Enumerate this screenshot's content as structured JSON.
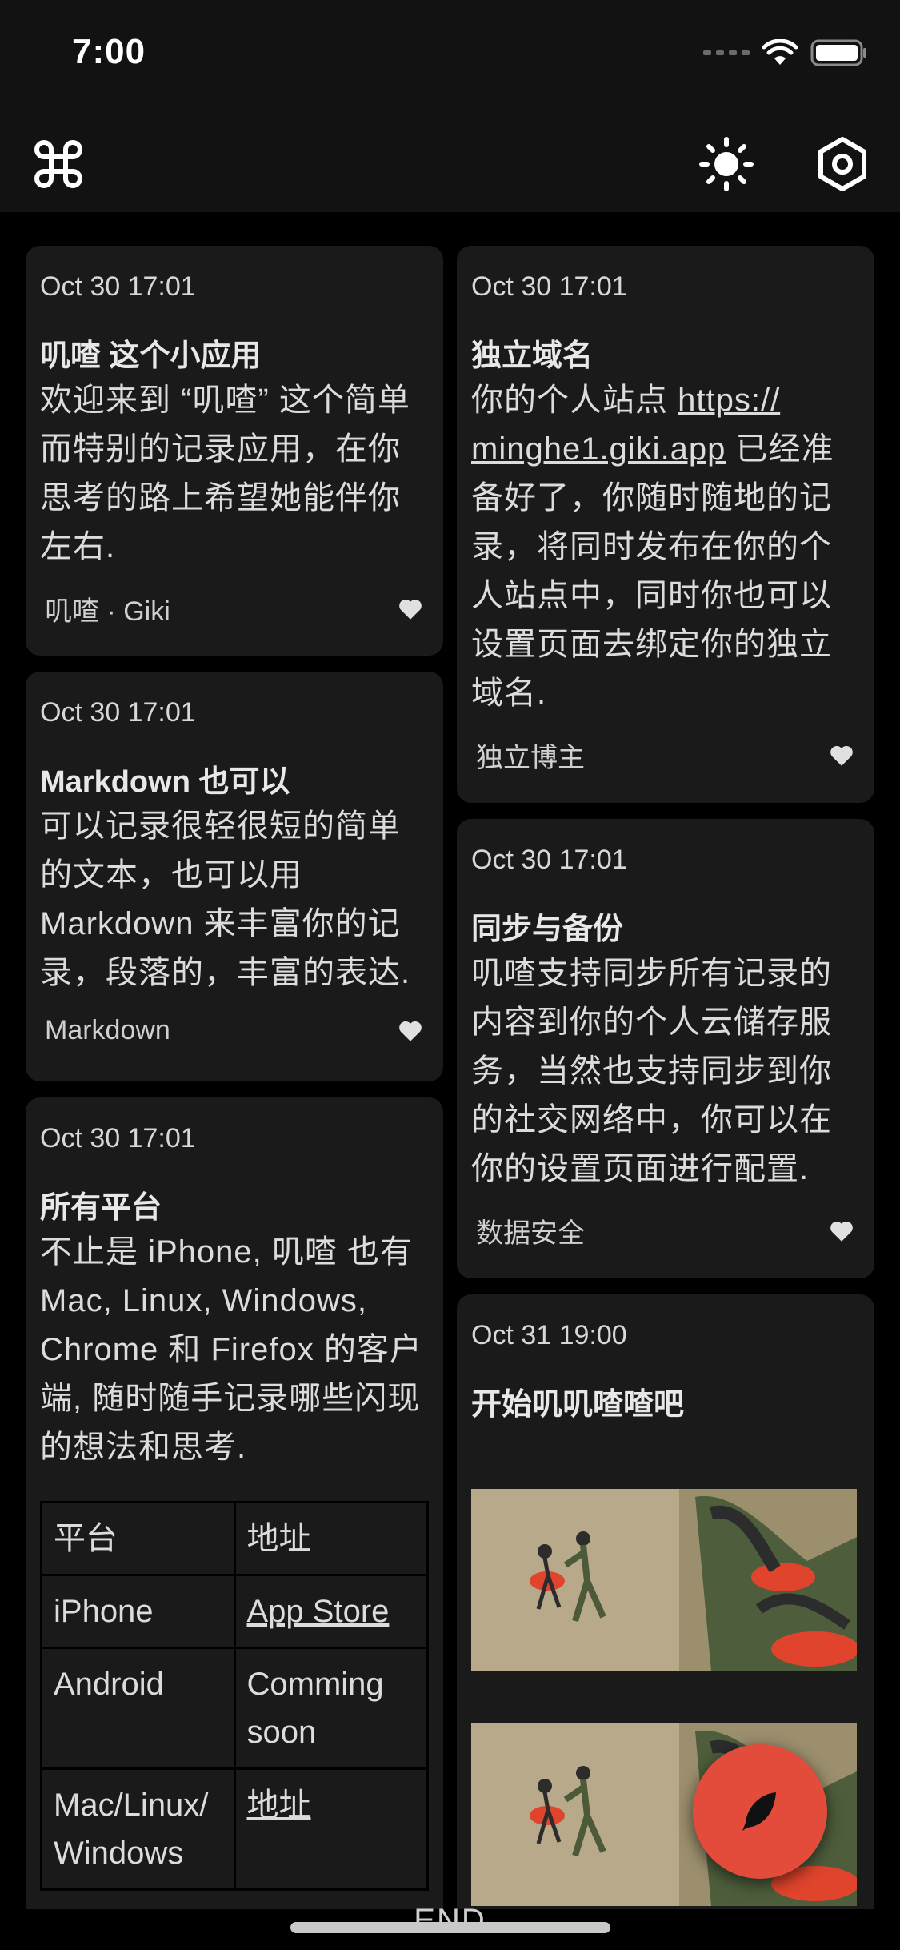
{
  "status": {
    "time": "7:00"
  },
  "toolbar": {
    "menu_icon": "command-icon",
    "theme_icon": "sun-icon",
    "settings_icon": "hexagon-settings-icon"
  },
  "cards": {
    "intro": {
      "date": "Oct 30 17:01",
      "title": "叽喳 这个小应用",
      "body": "欢迎来到 “叽喳” 这个简单而特别的记录应用，在你思考的路上希望她能伴你左右.",
      "tag": "叽喳 · Giki"
    },
    "markdown": {
      "date": "Oct 30 17:01",
      "title": "Markdown 也可以",
      "body": "可以记录很轻很短的简单的文本，也可以用 Markdown 来丰富你的记录，段落的，丰富的表达.",
      "tag": "Markdown"
    },
    "platforms": {
      "date": "Oct 30 17:01",
      "title": "所有平台",
      "body": "不止是 iPhone, 叽喳 也有 Mac, Linux, Windows, Chrome 和 Firefox 的客户端, 随时随手记录哪些闪现的想法和思考.",
      "table": {
        "h1": "平台",
        "h2": "地址",
        "r1c1": "iPhone",
        "r1c2": "App Store",
        "r2c1": "Android",
        "r2c2": "Comming soon",
        "r3c1": "Mac/Linux/ Windows",
        "r3c2": "地址"
      }
    },
    "domain": {
      "date": "Oct 30 17:01",
      "title": "独立域名",
      "body_pre": "你的个人站点 ",
      "link": "https:// minghe1.giki.app",
      "body_post": " 已经准备好了，你随时随地的记录，将同时发布在你的个人站点中，同时你也可以设置页面去绑定你的独立域名.",
      "tag": "独立博主"
    },
    "sync": {
      "date": "Oct 30 17:01",
      "title": "同步与备份",
      "body": "叽喳支持同步所有记录的内容到你的个人云储存服务，当然也支持同步到你的社交网络中，你可以在你的设置页面进行配置.",
      "tag": "数据安全"
    },
    "start": {
      "date": "Oct 31 19:00",
      "title": "开始叽叽喳喳吧"
    }
  },
  "footer": {
    "end": "END"
  },
  "colors": {
    "fab": "#e34b3b",
    "card": "#1a1a1a",
    "bar": "#121212"
  }
}
